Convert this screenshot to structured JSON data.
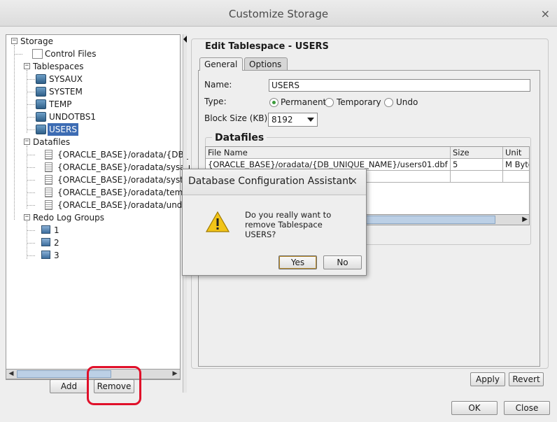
{
  "window": {
    "title": "Customize Storage",
    "close_glyph": "×"
  },
  "tree": {
    "root": "Storage",
    "control_files": "Control Files",
    "tablespaces_label": "Tablespaces",
    "tablespaces": [
      "SYSAUX",
      "SYSTEM",
      "TEMP",
      "UNDOTBS1",
      "USERS"
    ],
    "selected": "USERS",
    "datafiles_label": "Datafiles",
    "datafiles": [
      "{ORACLE_BASE}/oradata/{DB_",
      "{ORACLE_BASE}/oradata/sysau",
      "{ORACLE_BASE}/oradata/syste",
      "{ORACLE_BASE}/oradata/temp",
      "{ORACLE_BASE}/oradata/undo"
    ],
    "redo_label": "Redo Log Groups",
    "redo_groups": [
      "1",
      "2",
      "3"
    ],
    "expand_glyph": "−"
  },
  "left_buttons": {
    "add": "Add",
    "remove": "Remove"
  },
  "edit": {
    "title": "Edit Tablespace - USERS",
    "tabs": [
      "General",
      "Options"
    ],
    "name_label": "Name:",
    "name_value": "USERS",
    "type_label": "Type:",
    "type_options": [
      "Permanent",
      "Temporary",
      "Undo"
    ],
    "type_selected": "Permanent",
    "block_size_label": "Block Size (KB):",
    "block_size_value": "8192",
    "datafiles_title": "Datafiles",
    "columns": [
      "File Name",
      "Size",
      "Unit"
    ],
    "rows": [
      {
        "file": "{ORACLE_BASE}/oradata/{DB_UNIQUE_NAME}/users01.dbf",
        "size": "5",
        "unit": "M Bytes"
      }
    ]
  },
  "right_buttons": {
    "apply": "Apply",
    "revert": "Revert"
  },
  "footer": {
    "ok": "OK",
    "close": "Close"
  },
  "dialog": {
    "title": "Database Configuration Assistant",
    "close_glyph": "×",
    "message_lines": [
      "Do you really want to",
      "remove Tablespace",
      "USERS?"
    ],
    "yes": "Yes",
    "no": "No"
  },
  "colors": {
    "selection": "#3d6cb3",
    "highlight": "#e0102a",
    "radio_checked": "#3a9a3a"
  }
}
